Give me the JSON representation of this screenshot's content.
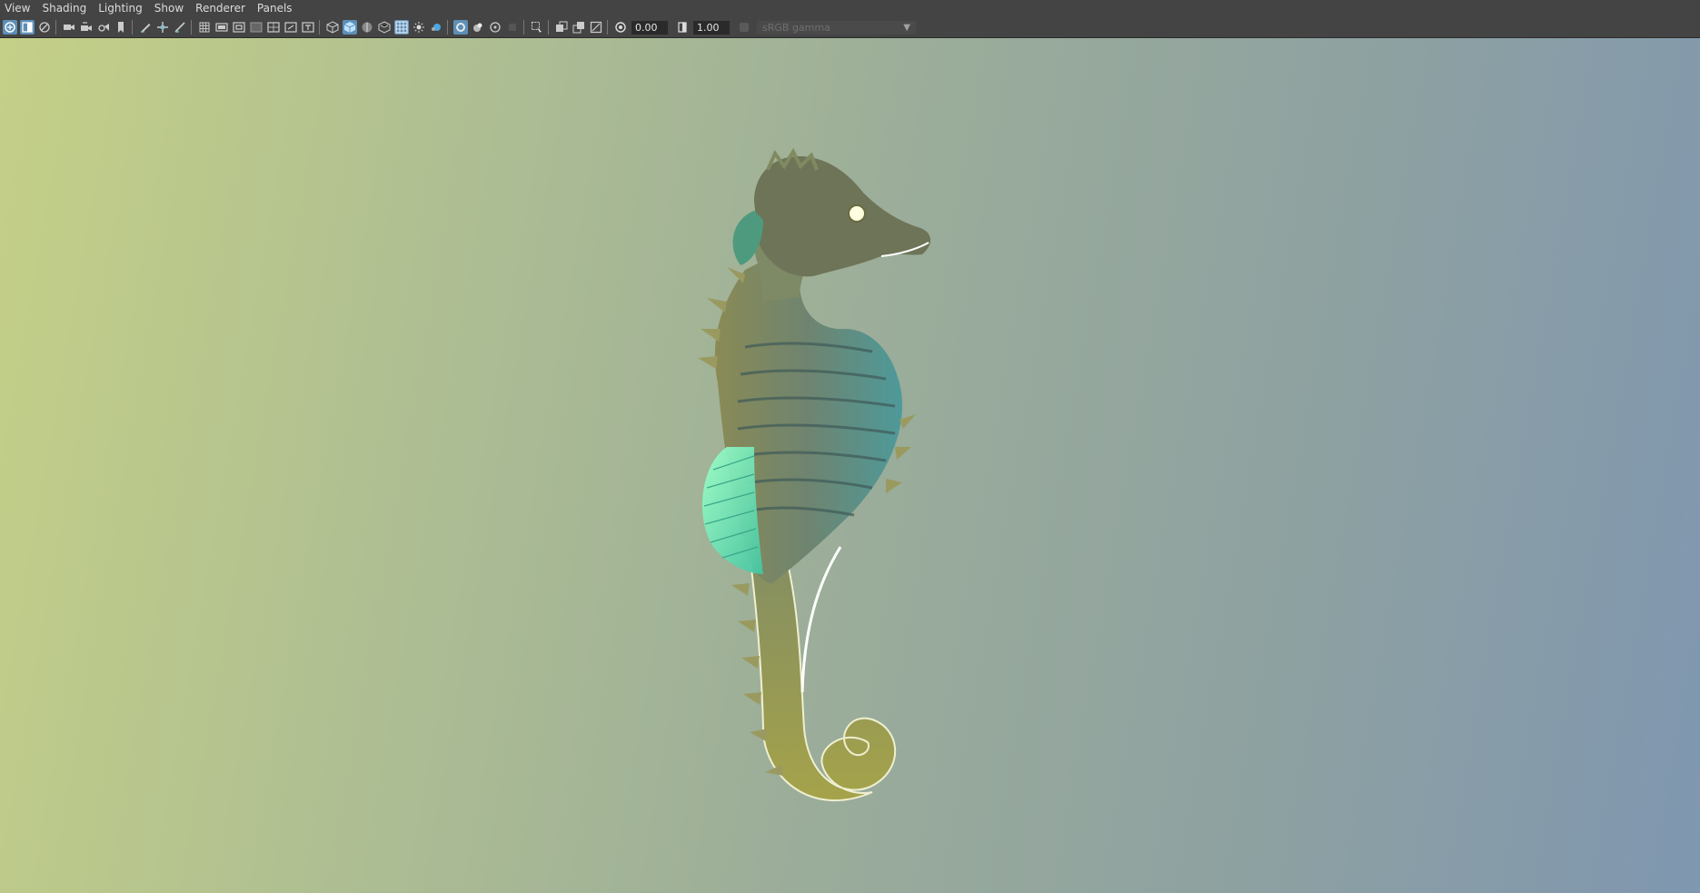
{
  "menu": {
    "items": [
      "View",
      "Shading",
      "Lighting",
      "Show",
      "Renderer",
      "Panels"
    ]
  },
  "toolbar": {
    "exposure_value": "0.00",
    "gamma_value": "1.00",
    "color_space_label": "sRGB gamma",
    "icons": [
      "select-camera-icon",
      "camera-attr-icon",
      "bookmark-icon",
      "camera-icon",
      "camera-move-icon",
      "camera-dolly-icon",
      "film-gate-marker-icon",
      "grease-pencil-icon",
      "snap-move-icon",
      "ruler-icon",
      "grid-icon",
      "film-gate-icon",
      "resolution-gate-icon",
      "gate-mask-icon",
      "field-chart-icon",
      "safe-action-icon",
      "safe-title-icon",
      "wireframe-icon",
      "smooth-shade-icon",
      "wireframe-on-shaded-icon",
      "textured-icon",
      "use-all-lights-icon",
      "shadows-icon",
      "screen-space-ao-icon",
      "motion-blur-icon",
      "anti-alias-icon",
      "depth-of-field-icon",
      "xray-icon",
      "xray-active-icon",
      "xray-joints-icon",
      "isolate-select-icon",
      "isolate-2-icon",
      "backface-icon",
      "exposure-icon",
      "gamma-icon",
      "color-management-icon"
    ]
  },
  "viewport": {
    "gradient_colors": [
      "#c4d087",
      "#adbd93",
      "#9aac9a",
      "#8ea1a1",
      "#7f97b0"
    ]
  }
}
